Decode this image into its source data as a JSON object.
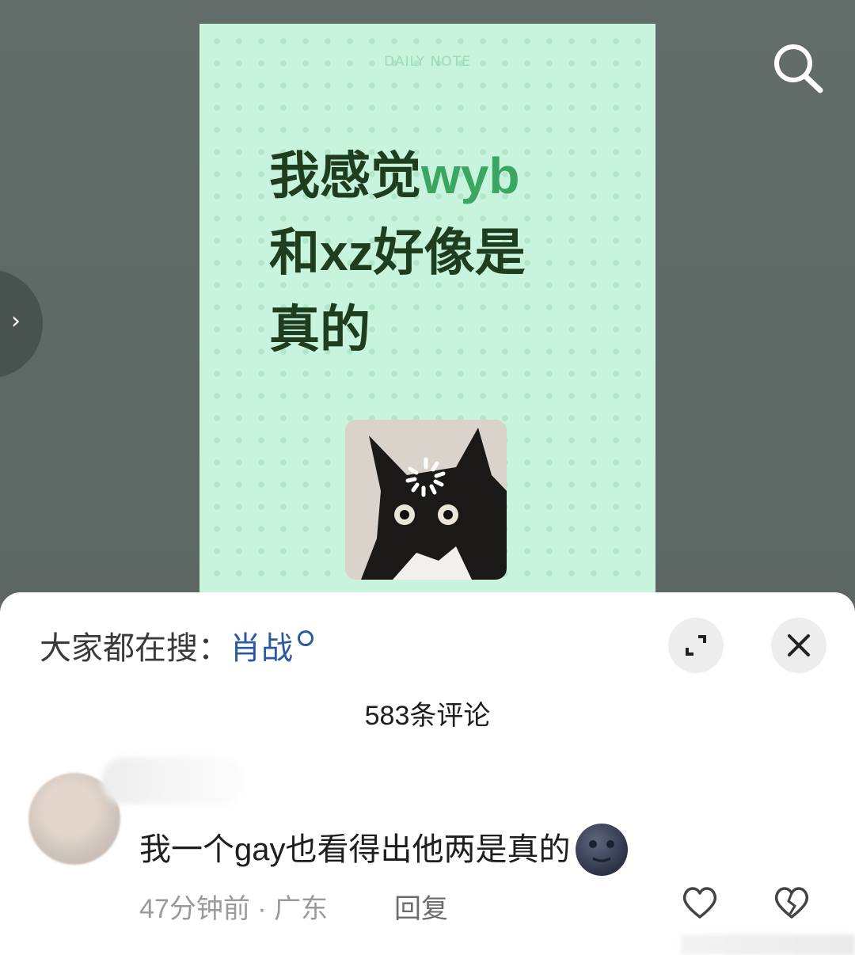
{
  "post": {
    "note_header": "DAILY NOTE",
    "line1_prefix": "我感觉",
    "line1_highlight": "wyb",
    "line2": "和xz好像是",
    "line3": "真的",
    "meme_icon": "loading-spinner-cat"
  },
  "toolbar": {
    "search_icon": "search-icon",
    "side_arrow": "›"
  },
  "comments_sheet": {
    "trending_label": "大家都在搜：",
    "trending_term": "肖战",
    "comment_count": "583条评论",
    "comment": {
      "text": "我一个gay也看得出他两是真的",
      "emoji": "new-moon-face",
      "time": "47分钟前",
      "separator": "·",
      "location": "广东",
      "reply_label": "回复"
    }
  },
  "colors": {
    "note_bg": "#c8f3dd",
    "highlight": "#3aa661",
    "link": "#2c5aa0"
  }
}
